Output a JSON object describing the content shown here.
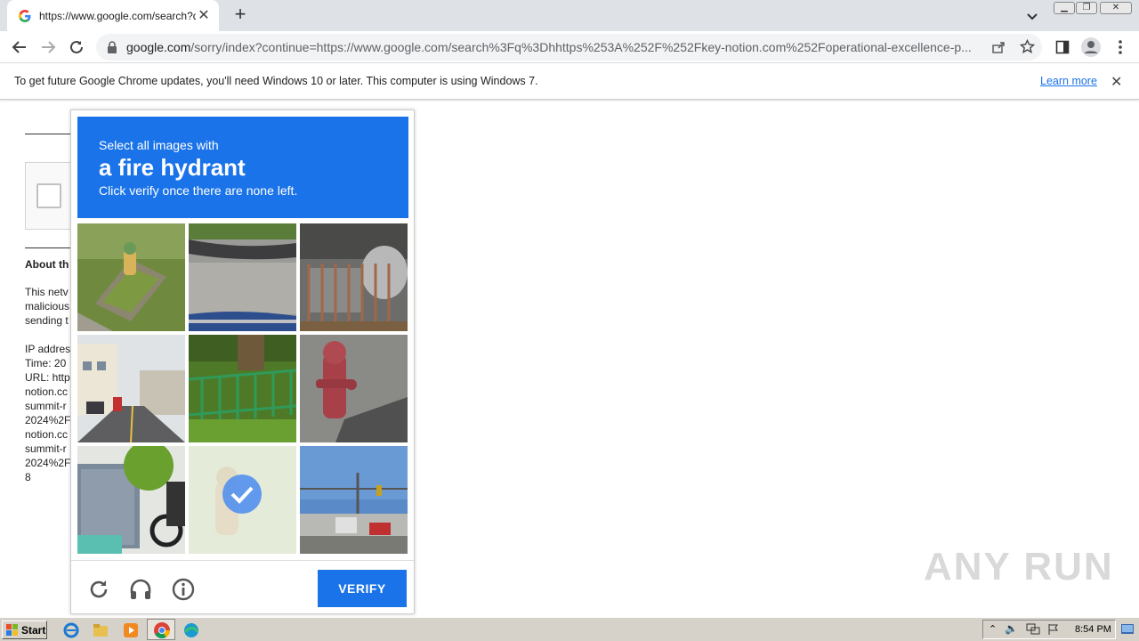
{
  "browser": {
    "tab_title": "https://www.google.com/search?q=",
    "new_tab_label": "+",
    "url_domain": "google.com",
    "url_path": "/sorry/index?continue=https://www.google.com/search%3Fq%3Dhhttps%253A%252F%252Fkey-notion.com%252Foperational-excellence-p..."
  },
  "infobar": {
    "message": "To get future Google Chrome updates, you'll need Windows 10 or later. This computer is using Windows 7.",
    "learn_more": "Learn more",
    "close": "✕"
  },
  "page": {
    "about_heading": "About th",
    "lines1": [
      "This netv",
      "malicious",
      "sending t"
    ],
    "lines2": [
      "IP addres",
      "Time: 20",
      "URL: http",
      "notion.cc",
      "summit-r",
      "2024%2F",
      "notion.cc",
      "summit-r",
      "2024%2F",
      "8"
    ]
  },
  "captcha": {
    "instruction_line1": "Select all images with",
    "target_object": "a fire hydrant",
    "instruction_line3": "Click verify once there are none left.",
    "verify_label": "VERIFY",
    "tiles": [
      {
        "name": "hydrant-in-grass",
        "selected": false
      },
      {
        "name": "car-wheel-road",
        "selected": false
      },
      {
        "name": "car-behind-fence",
        "selected": false
      },
      {
        "name": "street-with-buildings",
        "selected": false
      },
      {
        "name": "green-fence-garden",
        "selected": false
      },
      {
        "name": "red-fire-hydrant",
        "selected": false
      },
      {
        "name": "scooter-and-bin",
        "selected": false
      },
      {
        "name": "faded-hydrant",
        "selected": true
      },
      {
        "name": "traffic-intersection",
        "selected": false
      }
    ]
  },
  "watermark": "ANY RUN",
  "taskbar": {
    "start_label": "Start",
    "clock": "8:54 PM"
  },
  "colors": {
    "accent": "#1a73e8",
    "tab_strip": "#dee1e6",
    "taskbar": "#d6d2c9"
  }
}
